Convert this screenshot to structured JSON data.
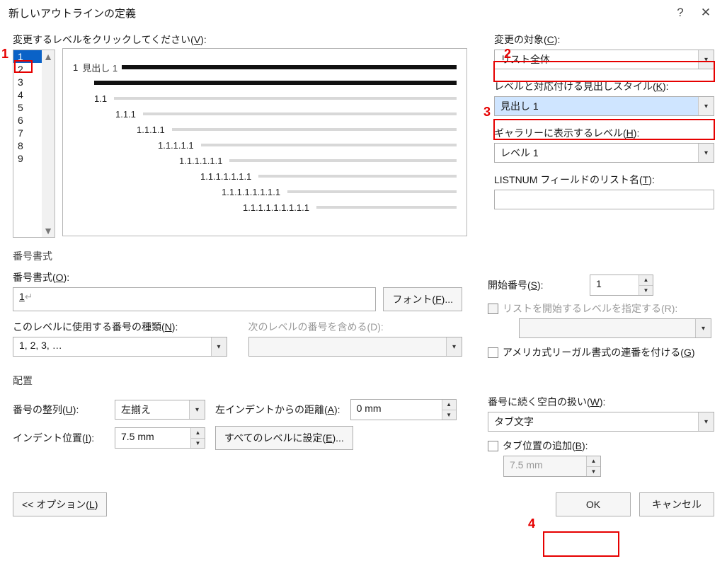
{
  "title": "新しいアウトラインの定義",
  "levels_label_pre": "変更するレベルをクリックしてください(",
  "levels_label_mn": "V",
  "levels_label_post": "):",
  "levels": [
    "1",
    "2",
    "3",
    "4",
    "5",
    "6",
    "7",
    "8",
    "9"
  ],
  "preview": {
    "rows": [
      {
        "indent": 0,
        "num": "1",
        "style": "見出し 1",
        "black": true,
        "secondBar": true
      },
      {
        "indent": 30,
        "num": "1.1",
        "black": false
      },
      {
        "indent": 60,
        "num": "1.1.1",
        "black": false
      },
      {
        "indent": 90,
        "num": "1.1.1.1",
        "black": false
      },
      {
        "indent": 120,
        "num": "1.1.1.1.1",
        "black": false
      },
      {
        "indent": 150,
        "num": "1.1.1.1.1.1",
        "black": false
      },
      {
        "indent": 180,
        "num": "1.1.1.1.1.1.1",
        "black": false
      },
      {
        "indent": 210,
        "num": "1.1.1.1.1.1.1.1",
        "black": false
      },
      {
        "indent": 240,
        "num": "1.1.1.1.1.1.1.1.1",
        "black": false
      }
    ]
  },
  "right": {
    "applyto_lbl_pre": "変更の対象(",
    "applyto_mn": "C",
    "applyto_lbl_post": "):",
    "applyto_val": "リスト全体",
    "linkstyle_lbl_pre": "レベルと対応付ける見出しスタイル(",
    "linkstyle_mn": "K",
    "linkstyle_lbl_post": "):",
    "linkstyle_val": "見出し 1",
    "gallery_lbl_pre": "ギャラリーに表示するレベル(",
    "gallery_mn": "H",
    "gallery_lbl_post": "):",
    "gallery_val": "レベル 1",
    "listnum_lbl_pre": "LISTNUM フィールドのリスト名(",
    "listnum_mn": "T",
    "listnum_lbl_post": "):",
    "listnum_val": ""
  },
  "numfmt": {
    "section": "番号書式",
    "fmt_lbl_pre": "番号書式(",
    "fmt_mn": "O",
    "fmt_lbl_post": "):",
    "fmt_val": "1",
    "font_btn_pre": "フォント(",
    "font_mn": "F",
    "font_btn_post": ")...",
    "type_lbl_pre": "このレベルに使用する番号の種類(",
    "type_mn": "N",
    "type_lbl_post": "):",
    "type_val": "1, 2, 3, …",
    "include_lbl": "次のレベルの番号を含める(D):",
    "include_val": "",
    "start_lbl_pre": "開始番号(",
    "start_mn": "S",
    "start_lbl_post": "):",
    "start_val": "1",
    "restart_lbl": "リストを開始するレベルを指定する(R):",
    "legal_lbl_pre": "アメリカ式リーガル書式の連番を付ける(",
    "legal_mn": "G",
    "legal_lbl_post": ")"
  },
  "layout": {
    "section": "配置",
    "align_lbl_pre": "番号の整列(",
    "align_mn": "U",
    "align_lbl_post": "):",
    "align_val": "左揃え",
    "leftindent_lbl_pre": "左インデントからの距離(",
    "leftindent_mn": "A",
    "leftindent_lbl_post": "):",
    "leftindent_val": "0 mm",
    "indentpos_lbl_pre": "インデント位置(",
    "indentpos_mn": "I",
    "indentpos_lbl_post": "):",
    "indentpos_val": "7.5 mm",
    "setall_pre": "すべてのレベルに設定(",
    "setall_mn": "E",
    "setall_post": ")...",
    "follow_lbl_pre": "番号に続く空白の扱い(",
    "follow_mn": "W",
    "follow_lbl_post": "):",
    "follow_val": "タブ文字",
    "tabadd_lbl_pre": "タブ位置の追加(",
    "tabadd_mn": "B",
    "tabadd_lbl_post": "):",
    "tabadd_val": "7.5 mm"
  },
  "buttons": {
    "options_pre": "<< オプション(",
    "options_mn": "L",
    "options_post": ")",
    "ok": "OK",
    "cancel": "キャンセル",
    "help": "?",
    "close": "✕"
  },
  "ann": {
    "a1": "1",
    "a2": "2",
    "a3": "3",
    "a4": "4"
  }
}
